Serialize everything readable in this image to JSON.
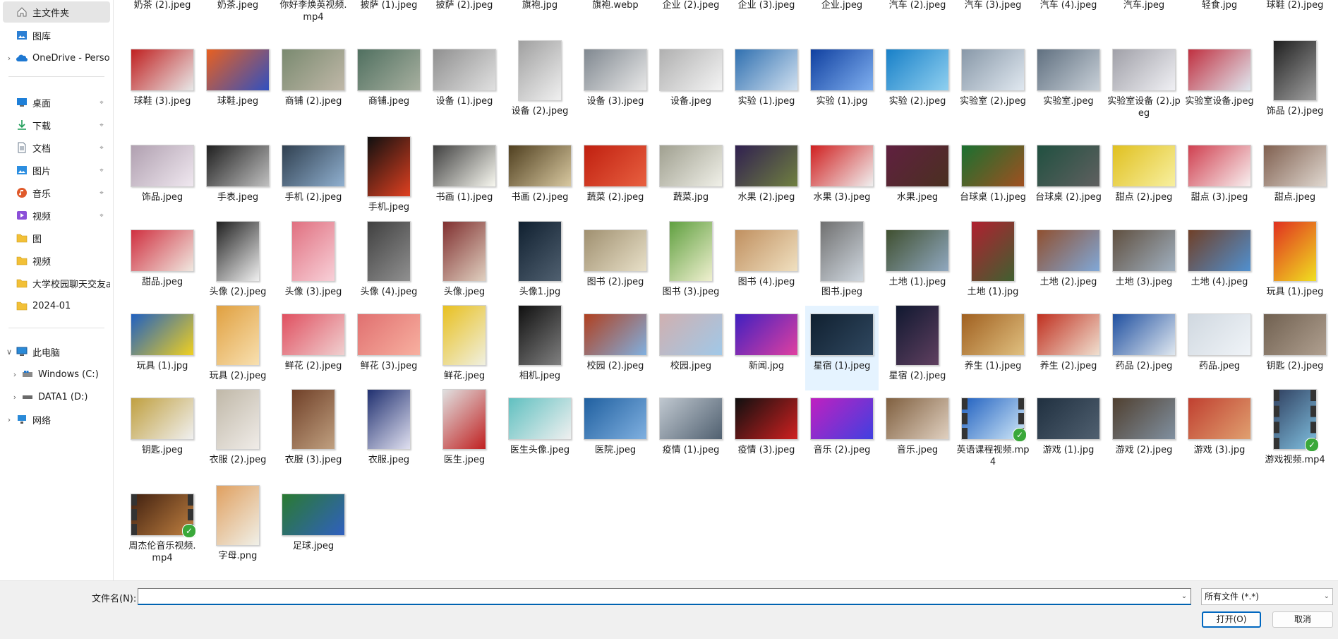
{
  "nav": {
    "home": "主文件夹",
    "gallery": "图库",
    "onedrive": "OneDrive - Perso",
    "quick_access": [
      {
        "label": "桌面",
        "icon": "desktop-icon",
        "color": "#1e7fd8"
      },
      {
        "label": "下载",
        "icon": "download-icon",
        "color": "#1a9b55"
      },
      {
        "label": "文档",
        "icon": "document-icon",
        "color": "#6b7b8c"
      },
      {
        "label": "图片",
        "icon": "pictures-icon",
        "color": "#2c8ee0"
      },
      {
        "label": "音乐",
        "icon": "music-icon",
        "color": "#e05a2b"
      },
      {
        "label": "视频",
        "icon": "video-icon",
        "color": "#8b4fd8"
      },
      {
        "label": "图",
        "icon": "folder-icon",
        "color": "#f2c037"
      },
      {
        "label": "视频",
        "icon": "folder-icon",
        "color": "#f2c037"
      },
      {
        "label": "大学校园聊天交友a",
        "icon": "folder-icon",
        "color": "#f2c037"
      },
      {
        "label": "2024-01",
        "icon": "folder-icon",
        "color": "#f2c037"
      }
    ],
    "this_pc": "此电脑",
    "drives": [
      {
        "label": "Windows (C:)",
        "icon": "windows-drive-icon"
      },
      {
        "label": "DATA1 (D:)",
        "icon": "drive-icon"
      }
    ],
    "network": "网络"
  },
  "files": [
    {
      "name": "奶茶 (2).jpeg",
      "c1": "#c8a27a",
      "c2": "#f0e4d0"
    },
    {
      "name": "奶茶.jpeg",
      "c1": "#b08060",
      "c2": "#f2e6d8"
    },
    {
      "name": "你好李焕英视频.mp4",
      "c1": "#7a5a4a",
      "c2": "#c9a080",
      "video": true
    },
    {
      "name": "披萨 (1).jpeg",
      "c1": "#c45a2a",
      "c2": "#e9b060"
    },
    {
      "name": "披萨 (2).jpeg",
      "c1": "#a03a1a",
      "c2": "#d89040"
    },
    {
      "name": "旗袍.jpg",
      "c1": "#8a2030",
      "c2": "#e8c0b0"
    },
    {
      "name": "旗袍.webp",
      "c1": "#6a7a8a",
      "c2": "#d0d8e0"
    },
    {
      "name": "企业 (2).jpeg",
      "c1": "#4a90d8",
      "c2": "#c8e0f8"
    },
    {
      "name": "企业 (3).jpeg",
      "c1": "#3a6aa8",
      "c2": "#a8c8e8"
    },
    {
      "name": "企业.jpeg",
      "c1": "#5a6a7a",
      "c2": "#c8d0d8"
    },
    {
      "name": "汽车 (2).jpeg",
      "c1": "#404850",
      "c2": "#a0a8b0"
    },
    {
      "name": "汽车 (3).jpeg",
      "c1": "#203040",
      "c2": "#607080"
    },
    {
      "name": "汽车 (4).jpeg",
      "c1": "#303030",
      "c2": "#909090"
    },
    {
      "name": "汽车.jpeg",
      "c1": "#101820",
      "c2": "#506070"
    },
    {
      "name": "轻食.jpg",
      "c1": "#6a9a30",
      "c2": "#e8d8a0"
    },
    {
      "name": "球鞋 (2).jpeg",
      "c1": "#d04030",
      "c2": "#f0f0f0"
    },
    {
      "name": "球鞋 (3).jpeg",
      "c1": "#c02020",
      "c2": "#e8e8e8"
    },
    {
      "name": "球鞋.jpeg",
      "c1": "#e86020",
      "c2": "#3050c0"
    },
    {
      "name": "商铺 (2).jpeg",
      "c1": "#7a8a70",
      "c2": "#c0b8a8"
    },
    {
      "name": "商铺.jpeg",
      "c1": "#507060",
      "c2": "#a8b0a0"
    },
    {
      "name": "设备 (1).jpeg",
      "c1": "#909090",
      "c2": "#e0e0e0"
    },
    {
      "name": "设备 (2).jpeg",
      "c1": "#a0a0a0",
      "c2": "#f0f0f0",
      "tall": true
    },
    {
      "name": "设备 (3).jpeg",
      "c1": "#808890",
      "c2": "#e8e8e8"
    },
    {
      "name": "设备.jpeg",
      "c1": "#b0b0b0",
      "c2": "#f4f4f4"
    },
    {
      "name": "实验 (1).jpeg",
      "c1": "#3070b0",
      "c2": "#d0e0f0"
    },
    {
      "name": "实验 (1).jpg",
      "c1": "#1040a0",
      "c2": "#80b0f0"
    },
    {
      "name": "实验 (2).jpeg",
      "c1": "#1880c8",
      "c2": "#90d0f0"
    },
    {
      "name": "实验室 (2).jpeg",
      "c1": "#8898a8",
      "c2": "#e0e8f0"
    },
    {
      "name": "实验室.jpeg",
      "c1": "#607080",
      "c2": "#c8d0d8"
    },
    {
      "name": "实验室设备 (2).jpeg",
      "c1": "#a0a0a8",
      "c2": "#f0f0f4"
    },
    {
      "name": "实验室设备.jpeg",
      "c1": "#c03040",
      "c2": "#e0e8f0"
    },
    {
      "name": "饰品 (2).jpeg",
      "c1": "#202020",
      "c2": "#a0a0a0",
      "tall": true
    },
    {
      "name": "饰品.jpeg",
      "c1": "#b0a0b0",
      "c2": "#f0e8f0"
    },
    {
      "name": "手表.jpeg",
      "c1": "#202020",
      "c2": "#c0c0c0"
    },
    {
      "name": "手机 (2).jpeg",
      "c1": "#304050",
      "c2": "#90b0d0"
    },
    {
      "name": "手机.jpeg",
      "c1": "#101010",
      "c2": "#e04020",
      "tall": true
    },
    {
      "name": "书画 (1).jpeg",
      "c1": "#404040",
      "c2": "#f8f8f0"
    },
    {
      "name": "书画 (2).jpeg",
      "c1": "#504020",
      "c2": "#d8c8a0"
    },
    {
      "name": "蔬菜 (2).jpeg",
      "c1": "#c02010",
      "c2": "#e86040"
    },
    {
      "name": "蔬菜.jpg",
      "c1": "#a0a090",
      "c2": "#f0f0e8"
    },
    {
      "name": "水果 (2).jpeg",
      "c1": "#302050",
      "c2": "#708040"
    },
    {
      "name": "水果 (3).jpeg",
      "c1": "#d02020",
      "c2": "#f0f0f0"
    },
    {
      "name": "水果.jpeg",
      "c1": "#602040",
      "c2": "#4a3020"
    },
    {
      "name": "台球桌 (1).jpeg",
      "c1": "#1a7030",
      "c2": "#a05020"
    },
    {
      "name": "台球桌 (2).jpeg",
      "c1": "#205040",
      "c2": "#606060"
    },
    {
      "name": "甜点 (2).jpeg",
      "c1": "#e0c020",
      "c2": "#f8f0a0"
    },
    {
      "name": "甜点 (3).jpeg",
      "c1": "#d04050",
      "c2": "#f8f0f0"
    },
    {
      "name": "甜点.jpeg",
      "c1": "#806050",
      "c2": "#e0d8d0"
    },
    {
      "name": "甜品.jpeg",
      "c1": "#d03040",
      "c2": "#f0e8e0"
    },
    {
      "name": "头像 (2).jpeg",
      "c1": "#202020",
      "c2": "#f0f0f0",
      "tall": true
    },
    {
      "name": "头像 (3).jpeg",
      "c1": "#e07080",
      "c2": "#f8d0d8",
      "tall": true
    },
    {
      "name": "头像 (4).jpeg",
      "c1": "#404040",
      "c2": "#909090",
      "tall": true
    },
    {
      "name": "头像.jpeg",
      "c1": "#803030",
      "c2": "#e0d0c0",
      "tall": true
    },
    {
      "name": "头像1.jpg",
      "c1": "#102030",
      "c2": "#506070",
      "tall": true
    },
    {
      "name": "图书 (2).jpeg",
      "c1": "#a09070",
      "c2": "#e8e0c8"
    },
    {
      "name": "图书 (3).jpeg",
      "c1": "#60a040",
      "c2": "#f0f0d0",
      "tall": true
    },
    {
      "name": "图书 (4).jpeg",
      "c1": "#c09060",
      "c2": "#f0e0c0"
    },
    {
      "name": "图书.jpeg",
      "c1": "#707070",
      "c2": "#d0d8e0",
      "tall": true
    },
    {
      "name": "土地 (1).jpeg",
      "c1": "#405030",
      "c2": "#90a8c0"
    },
    {
      "name": "土地 (1).jpg",
      "c1": "#b02030",
      "c2": "#406030",
      "tall": true
    },
    {
      "name": "土地 (2).jpeg",
      "c1": "#905030",
      "c2": "#80a8d8"
    },
    {
      "name": "土地 (3).jpeg",
      "c1": "#605040",
      "c2": "#a0b0c0"
    },
    {
      "name": "土地 (4).jpeg",
      "c1": "#704028",
      "c2": "#5090d0"
    },
    {
      "name": "玩具 (1).jpeg",
      "c1": "#e03020",
      "c2": "#f0e020",
      "tall": true
    },
    {
      "name": "玩具 (1).jpg",
      "c1": "#2060c0",
      "c2": "#f0d020"
    },
    {
      "name": "玩具 (2).jpeg",
      "c1": "#e0a040",
      "c2": "#f8e0b0",
      "tall": true
    },
    {
      "name": "鲜花 (2).jpeg",
      "c1": "#e05060",
      "c2": "#f0d0d0"
    },
    {
      "name": "鲜花 (3).jpeg",
      "c1": "#e07070",
      "c2": "#f8b0a0"
    },
    {
      "name": "鲜花.jpeg",
      "c1": "#e8c020",
      "c2": "#f0f0e0",
      "tall": true
    },
    {
      "name": "相机.jpeg",
      "c1": "#101010",
      "c2": "#808080",
      "tall": true
    },
    {
      "name": "校园 (2).jpeg",
      "c1": "#b04020",
      "c2": "#80b0e0"
    },
    {
      "name": "校园.jpeg",
      "c1": "#d0b0b0",
      "c2": "#a0c8e8"
    },
    {
      "name": "新闻.jpg",
      "c1": "#4020c0",
      "c2": "#e040a0"
    },
    {
      "name": "星宿 (1).jpeg",
      "c1": "#102030",
      "c2": "#304860",
      "selected": true
    },
    {
      "name": "星宿 (2).jpeg",
      "c1": "#101830",
      "c2": "#604060",
      "tall": true
    },
    {
      "name": "养生 (1).jpeg",
      "c1": "#a06020",
      "c2": "#e0c080"
    },
    {
      "name": "养生 (2).jpeg",
      "c1": "#c03020",
      "c2": "#f0e0d0"
    },
    {
      "name": "药品 (2).jpeg",
      "c1": "#2050a0",
      "c2": "#e0e8f0"
    },
    {
      "name": "药品.jpeg",
      "c1": "#d0d8e0",
      "c2": "#f0f4f8"
    },
    {
      "name": "钥匙 (2).jpeg",
      "c1": "#706050",
      "c2": "#b0a090"
    },
    {
      "name": "钥匙.jpeg",
      "c1": "#c0a040",
      "c2": "#f0f0f0"
    },
    {
      "name": "衣服 (2).jpeg",
      "c1": "#c0b8a8",
      "c2": "#f0ece8",
      "tall": true
    },
    {
      "name": "衣服 (3).jpeg",
      "c1": "#704028",
      "c2": "#c0a080",
      "tall": true
    },
    {
      "name": "衣服.jpeg",
      "c1": "#203070",
      "c2": "#e0e0f0",
      "tall": true
    },
    {
      "name": "医生.jpeg",
      "c1": "#e0e0e0",
      "c2": "#c02020",
      "tall": true
    },
    {
      "name": "医生头像.jpeg",
      "c1": "#60c0c0",
      "c2": "#f0f0f0"
    },
    {
      "name": "医院.jpeg",
      "c1": "#2060a0",
      "c2": "#80b0e0"
    },
    {
      "name": "疫情 (1).jpeg",
      "c1": "#c0c8d0",
      "c2": "#506070"
    },
    {
      "name": "疫情 (3).jpeg",
      "c1": "#101010",
      "c2": "#d02020"
    },
    {
      "name": "音乐 (2).jpeg",
      "c1": "#c020c0",
      "c2": "#4040e0"
    },
    {
      "name": "音乐.jpeg",
      "c1": "#806040",
      "c2": "#e0d0c0"
    },
    {
      "name": "英语课程视频.mp4",
      "c1": "#2060c0",
      "c2": "#d0e8f8",
      "video": true
    },
    {
      "name": "游戏 (1).jpg",
      "c1": "#203040",
      "c2": "#506070"
    },
    {
      "name": "游戏 (2).jpeg",
      "c1": "#504030",
      "c2": "#8090a0"
    },
    {
      "name": "游戏 (3).jpg",
      "c1": "#c04030",
      "c2": "#e0a070"
    },
    {
      "name": "游戏视频.mp4",
      "c1": "#304060",
      "c2": "#80c0e0",
      "video": true,
      "tall": true
    },
    {
      "name": "周杰伦音乐视频.mp4",
      "c1": "#402010",
      "c2": "#c08040",
      "video": true
    },
    {
      "name": "字母.png",
      "c1": "#e0a060",
      "c2": "#f0f0e8",
      "tall": true
    },
    {
      "name": "足球.jpeg",
      "c1": "#2a7a30",
      "c2": "#3060c0"
    }
  ],
  "bottom": {
    "filename_label": "文件名(N):",
    "filename_value": "",
    "filter_value": "所有文件 (*.*)",
    "open_label": "打开(O)",
    "cancel_label": "取消"
  }
}
